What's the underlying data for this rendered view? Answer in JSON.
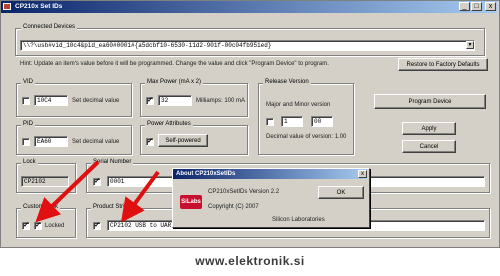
{
  "window": {
    "title": "CP210x Set IDs",
    "min_label": "_",
    "max_label": "□",
    "close_label": "x"
  },
  "device": {
    "group_label": "Connected Devices",
    "path": "\\\\?\\usb#vid_10c4&pid_ea60#0001#{a5dcbf10-6530-11d2-901f-00c04fb951ed}"
  },
  "note": "Hint: Update an item's value before it will be programmed. Change the value and click \"Program Device\" to program.",
  "reset_button": "Restore to Factory Defaults",
  "vid": {
    "group_label": "VID",
    "value": "10C4",
    "side_label": "Set decimal value"
  },
  "pid": {
    "group_label": "PID",
    "value": "EA60",
    "side_label": "Set decimal value"
  },
  "max_power": {
    "group_label": "Max Power (mA x 2)",
    "value": "32",
    "side_label": "Milliamps: 100 mA"
  },
  "power_attributes": {
    "group_label": "Power Attributes",
    "checkbox_label": "Self-powered"
  },
  "release_version": {
    "group_label": "Release Version",
    "sub_label": "Major and Minor version",
    "major": "1",
    "minor": "00",
    "desc": "Decimal value of version: 1.00"
  },
  "buttons": {
    "program": "Program Device",
    "apply": "Apply",
    "cancel": "Cancel"
  },
  "serial_number": {
    "group_label": "Serial Number",
    "value": "0001"
  },
  "lock": {
    "group_label": "Lock",
    "value": "CP2102"
  },
  "product_string": {
    "group_label": "Product String",
    "value": "CP2102 USB to UART Bridge Controller"
  },
  "custom_lock": {
    "group_label": "Custom Lock",
    "checkbox_label": "Locked"
  },
  "about_dialog": {
    "title": "About CP210xSetIDs",
    "close_label": "x",
    "version_line": "CP210xSetIDs Version 2.2",
    "copyright_line": "Copyright (C) 2007",
    "company_line": "Silicon Laboratories",
    "ok_label": "OK",
    "logo_text": "SiLabs"
  },
  "watermark": "www.elektronik.si",
  "colors": {
    "title_start": "#0a246a",
    "title_end": "#a6caf0",
    "arrow": "#e01010",
    "face": "#d4d0c8"
  }
}
